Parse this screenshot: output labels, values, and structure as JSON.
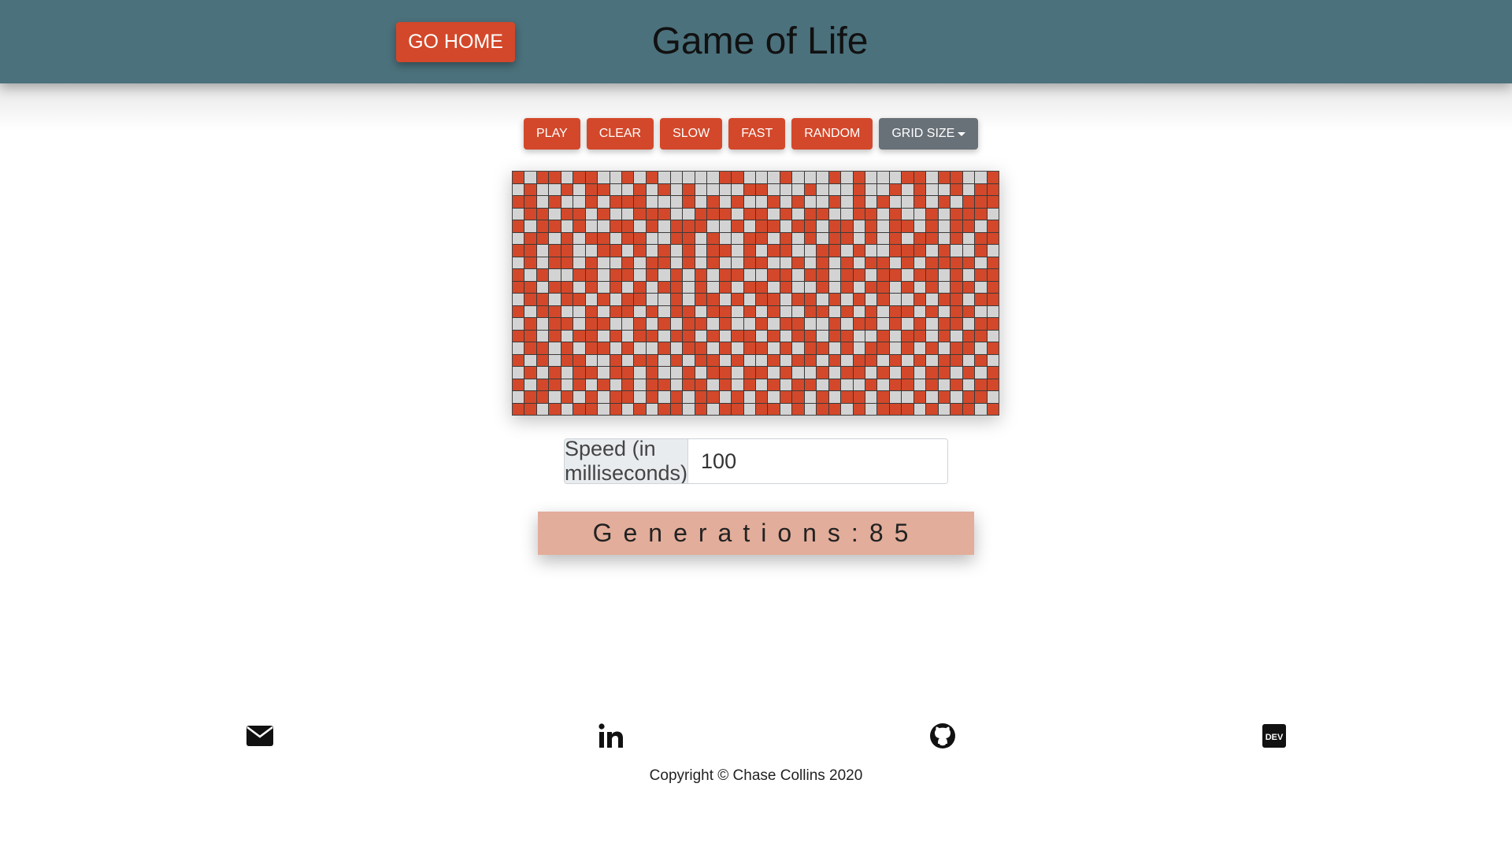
{
  "header": {
    "go_home_label": "GO HOME",
    "title": "Game of Life"
  },
  "controls": [
    {
      "label": "PLAY",
      "name": "play-button"
    },
    {
      "label": "CLEAR",
      "name": "clear-button"
    },
    {
      "label": "SLOW",
      "name": "slow-button"
    },
    {
      "label": "FAST",
      "name": "fast-button"
    },
    {
      "label": "RANDOM",
      "name": "random-button"
    },
    {
      "label": "GRID SIZE",
      "name": "grid-size-dropdown",
      "dropdown": true
    }
  ],
  "grid": {
    "rows": 20,
    "cols": 40,
    "alive_color": "#d3482a",
    "dead_color": "#d3d3d3",
    "cells": [
      "1011011001010000011000100010100011011001",
      "0100101100101010000110001000100101001011",
      "1101001011100010101001010010101001010111",
      "0110110100111001110110101100110100101110",
      "1011010011010111001011011011010110101101",
      "0110101101100110100110101011010101101011",
      "1101100110101010110101100110100111010010",
      "0101101001011010100110010101011010111101",
      "1010011011010101011001101101101101101011",
      "1101101010101101010110100101011010101101",
      "0110110101100101101011011010101001011011",
      "1011001011010110110101001101010110101100",
      "0101101100101011010010110010110101011011",
      "1101011010110110101101011011001011010110",
      "0110101101001011010110101101011010101101",
      "1010110010110101101001011010110101011010",
      "0101011011010010110110100101101010110101",
      "1011010101011011010101011010010110101011",
      "0110101011010101101010110101101001010110",
      "1101011010101101011011010110101110101101"
    ]
  },
  "speed": {
    "label": "Speed (in milliseconds)",
    "value": "100"
  },
  "generations": {
    "text": "Generations:85"
  },
  "footer": {
    "icons": [
      "email-icon",
      "linkedin-icon",
      "github-icon",
      "dev-icon"
    ],
    "copyright": "Copyright © Chase Collins 2020"
  }
}
